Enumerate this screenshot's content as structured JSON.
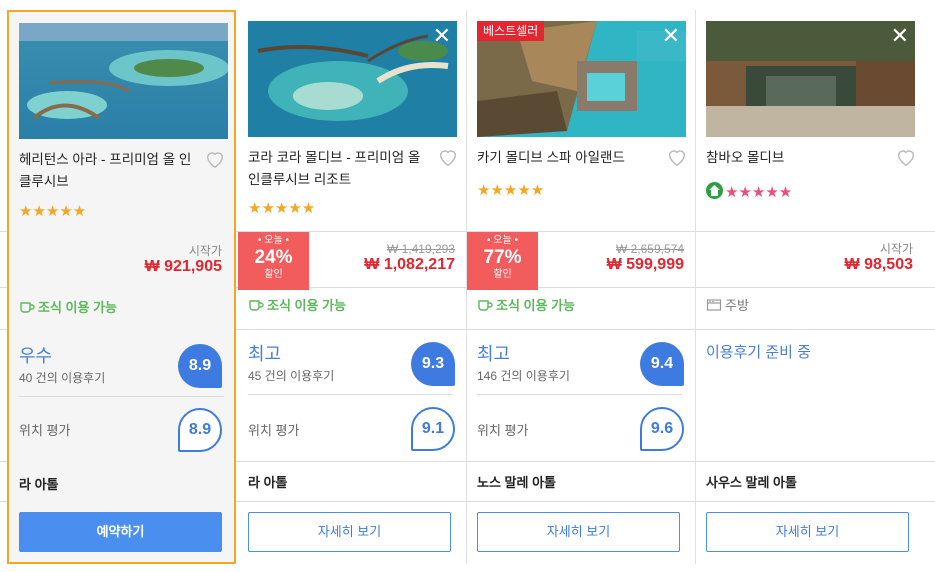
{
  "hotels": [
    {
      "name": "헤리턴스 아라 - 프리미엄 올 인클루시브",
      "stars": "★★★★★",
      "price_label": "시작가",
      "price": "₩ 921,905",
      "amenity": "조식 이용 가능",
      "rating_word": "우수",
      "review_count": "40 건의 이용후기",
      "score": "8.9",
      "location_label": "위치 평가",
      "location_score": "8.9",
      "area": "라 아톨",
      "button": "예약하기"
    },
    {
      "name": "코라 코라 몰디브 - 프리미엄 올 인클루시브 리조트",
      "stars": "★★★★★",
      "deal_top": "• 오늘 •",
      "deal_percent": "24%",
      "deal_bottom": "할인",
      "original_price": "₩ 1,419,293",
      "price": "₩ 1,082,217",
      "amenity": "조식 이용 가능",
      "rating_word": "최고",
      "review_count": "45 건의 이용후기",
      "score": "9.3",
      "location_label": "위치 평가",
      "location_score": "9.1",
      "area": "라 아톨",
      "button": "자세히 보기",
      "close": "✕"
    },
    {
      "name": "카기 몰디브 스파 아일랜드",
      "badge": "베스트셀러",
      "stars": "★★★★★",
      "deal_top": "• 오늘 •",
      "deal_percent": "77%",
      "deal_bottom": "할인",
      "original_price": "₩ 2,659,574",
      "price": "₩ 599,999",
      "amenity": "조식 이용 가능",
      "rating_word": "최고",
      "review_count": "146 건의 이용후기",
      "score": "9.4",
      "location_label": "위치 평가",
      "location_score": "9.6",
      "area": "노스 말레 아톨",
      "button": "자세히 보기",
      "close": "✕"
    },
    {
      "name": "참바오 몰디브",
      "stars": "★★★★★",
      "price_label": "시작가",
      "price": "₩ 98,503",
      "amenity": "주방",
      "rating_pending": "이용후기 준비 중",
      "area": "사우스 말레 아톨",
      "button": "자세히 보기",
      "close": "✕"
    }
  ],
  "colors": {
    "accent_blue": "#4a8ff0",
    "price_red": "#e3262f",
    "deal_red": "#f25c5c",
    "star_orange": "#f5a623",
    "star_pink": "#e8517a",
    "amenity_green": "#5cb85c",
    "selected_border": "#f5a623"
  }
}
